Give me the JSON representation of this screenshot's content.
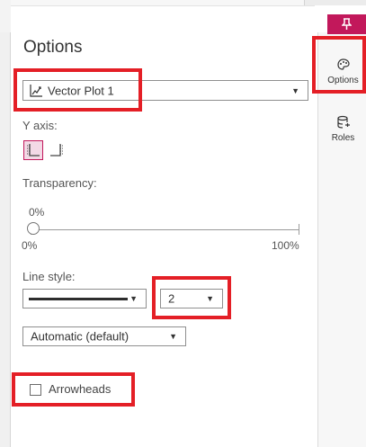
{
  "panel": {
    "title": "Options",
    "plot_select": {
      "value": "Vector Plot 1",
      "icon": "vector-plot-icon"
    },
    "y_axis": {
      "label": "Y axis:",
      "selected": "left"
    },
    "transparency": {
      "label": "Transparency:",
      "value_text": "0%",
      "value": 0,
      "min_label": "0%",
      "max_label": "100%"
    },
    "line_style": {
      "label": "Line style:",
      "pattern": "solid",
      "width_value": "2",
      "color_value": "Automatic (default)"
    },
    "arrowheads": {
      "label": "Arrowheads",
      "checked": false
    }
  },
  "side_panel": {
    "items": [
      {
        "label": "Options",
        "icon": "palette-icon"
      },
      {
        "label": "Roles",
        "icon": "database-icon"
      }
    ],
    "pin_icon": "pin-icon"
  },
  "colors": {
    "accent": "#c2185b",
    "highlight": "#e41f26"
  }
}
